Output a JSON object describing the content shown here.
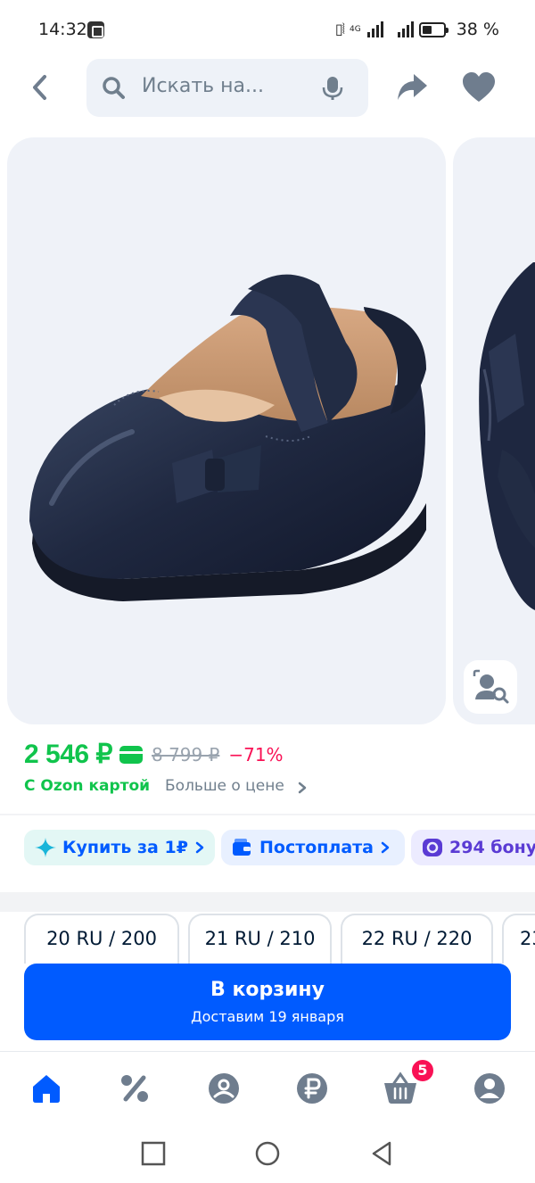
{
  "status_bar": {
    "time": "14:32",
    "network": "4G",
    "battery": "38 %"
  },
  "header": {
    "search_placeholder": "Искать на...",
    "icons": [
      "back-arrow-icon",
      "search-icon",
      "microphone-icon",
      "share-icon",
      "heart-icon"
    ]
  },
  "gallery": {
    "image_count_visible": 2,
    "visual_search_icon": "camera-search-icon"
  },
  "price": {
    "current": "2 546 ₽",
    "old": "8 799 ₽",
    "discount": "−71%",
    "ozon_card_label": "С Ozon картой",
    "more_label": "Больше о цене"
  },
  "chips": [
    {
      "label": "Купить за 1₽",
      "icon": "sparkle-icon"
    },
    {
      "label": "Постоплата",
      "icon": "wallet-icon"
    },
    {
      "label": "294 бону",
      "icon": "bonus-icon"
    }
  ],
  "sizes": [
    "20 RU / 200",
    "21 RU / 210",
    "22 RU / 220",
    "23"
  ],
  "cart": {
    "title": "В корзину",
    "delivery": "Доставим 19 января"
  },
  "bottom_nav": {
    "items": [
      "home-icon",
      "discount-icon",
      "fresh-icon",
      "finance-icon",
      "cart-icon",
      "profile-icon"
    ],
    "cart_badge": "5"
  },
  "colors": {
    "brand_blue": "#005bff",
    "price_green": "#10c44c",
    "discount_red": "#f91155",
    "surface": "#eff2f8"
  }
}
